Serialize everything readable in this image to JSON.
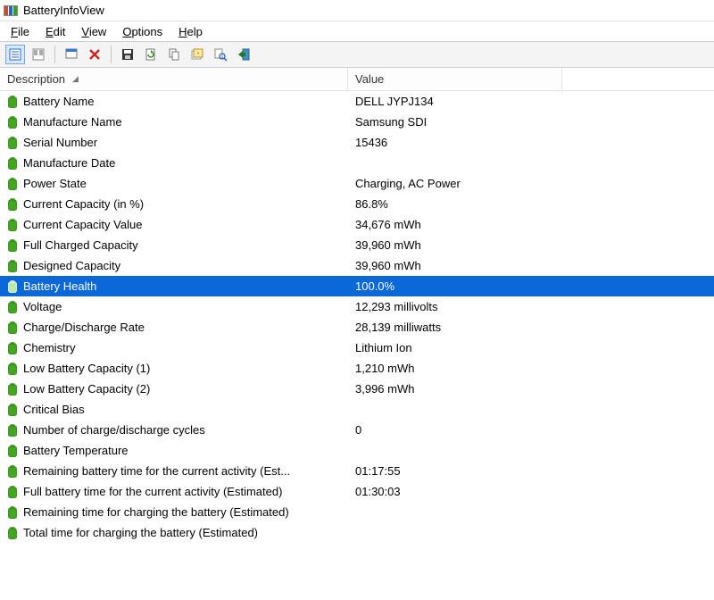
{
  "window": {
    "title": "BatteryInfoView"
  },
  "menu": {
    "file": {
      "label": "File",
      "ul": "F"
    },
    "edit": {
      "label": "Edit",
      "ul": "E"
    },
    "view": {
      "label": "View",
      "ul": "V"
    },
    "options": {
      "label": "Options",
      "ul": "O"
    },
    "help": {
      "label": "Help",
      "ul": "H"
    }
  },
  "columns": {
    "description": "Description",
    "value": "Value"
  },
  "rows": [
    {
      "desc": "Battery Name",
      "val": "DELL JYPJ134"
    },
    {
      "desc": "Manufacture Name",
      "val": "Samsung SDI"
    },
    {
      "desc": "Serial Number",
      "val": "15436"
    },
    {
      "desc": "Manufacture Date",
      "val": ""
    },
    {
      "desc": "Power State",
      "val": "Charging, AC Power"
    },
    {
      "desc": "Current Capacity (in %)",
      "val": "86.8%"
    },
    {
      "desc": "Current Capacity Value",
      "val": "34,676 mWh"
    },
    {
      "desc": "Full Charged Capacity",
      "val": "39,960 mWh"
    },
    {
      "desc": "Designed Capacity",
      "val": "39,960 mWh"
    },
    {
      "desc": "Battery Health",
      "val": "100.0%",
      "selected": true
    },
    {
      "desc": "Voltage",
      "val": "12,293 millivolts"
    },
    {
      "desc": "Charge/Discharge Rate",
      "val": "28,139 milliwatts"
    },
    {
      "desc": "Chemistry",
      "val": "Lithium Ion"
    },
    {
      "desc": "Low Battery Capacity (1)",
      "val": "1,210 mWh"
    },
    {
      "desc": "Low Battery Capacity (2)",
      "val": "3,996 mWh"
    },
    {
      "desc": "Critical Bias",
      "val": ""
    },
    {
      "desc": "Number of charge/discharge cycles",
      "val": "0"
    },
    {
      "desc": "Battery Temperature",
      "val": ""
    },
    {
      "desc": "Remaining battery time for the current activity (Est...",
      "val": "01:17:55"
    },
    {
      "desc": "Full battery time for the current activity (Estimated)",
      "val": "01:30:03"
    },
    {
      "desc": "Remaining time for charging the battery (Estimated)",
      "val": ""
    },
    {
      "desc": "Total  time for charging the battery (Estimated)",
      "val": ""
    }
  ]
}
